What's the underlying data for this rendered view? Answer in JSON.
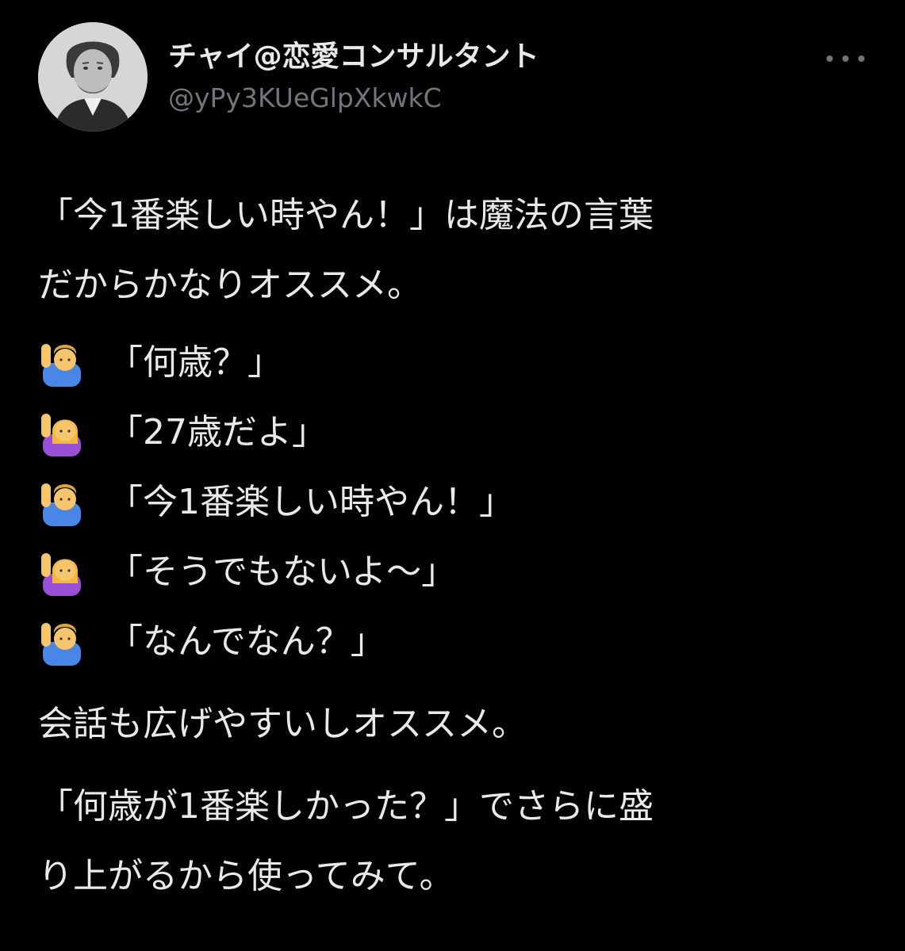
{
  "tweet": {
    "author": {
      "display_name": "チャイ@恋愛コンサルタント",
      "handle": "@yPy3KUeGlpXkwkC",
      "avatar_icon": "portrait-avatar"
    },
    "more_icon": "more-options-icon",
    "body": {
      "intro_line1": "「今1番楽しい時やん！」は魔法の言葉",
      "intro_line2": "だからかなりオススメ。",
      "dialog": [
        {
          "speaker_icon": "man-raising-hand-icon",
          "text": "「何歳？」"
        },
        {
          "speaker_icon": "woman-raising-hand-icon",
          "text": "「27歳だよ」"
        },
        {
          "speaker_icon": "man-raising-hand-icon",
          "text": "「今1番楽しい時やん！」"
        },
        {
          "speaker_icon": "woman-raising-hand-icon",
          "text": "「そうでもないよ〜」"
        },
        {
          "speaker_icon": "man-raising-hand-icon",
          "text": "「なんでなん？」"
        }
      ],
      "outro_line1": "会話も広げやすいしオススメ。",
      "closing_line1": "「何歳が1番楽しかった？」でさらに盛",
      "closing_line2": "り上がるから使ってみて。"
    },
    "colors": {
      "background": "#000000",
      "text": "#e7e9ea",
      "secondary_text": "#71767b"
    }
  }
}
